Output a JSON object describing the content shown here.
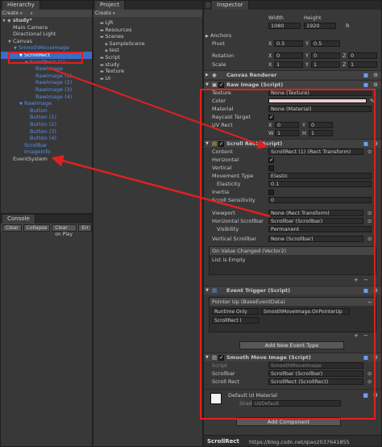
{
  "hierarchy": {
    "tab": "Hierarchy",
    "create": "Create",
    "search_icon": "search-icon",
    "scene": "study*",
    "items": [
      {
        "label": "Main Camera",
        "indent": 1,
        "style": "normal"
      },
      {
        "label": "Directional Light",
        "indent": 1,
        "style": "normal"
      },
      {
        "label": "Canvas",
        "indent": 1,
        "style": "normal"
      },
      {
        "label": "SmoothMoveImage",
        "indent": 2,
        "style": "blue"
      },
      {
        "label": "ScrollRect",
        "indent": 3,
        "style": "selected"
      },
      {
        "label": "ScrollRect (1)",
        "indent": 4,
        "style": "blue"
      },
      {
        "label": "RawImage",
        "indent": 5,
        "style": "blue"
      },
      {
        "label": "RawImage (1)",
        "indent": 5,
        "style": "blue"
      },
      {
        "label": "RawImage (2)",
        "indent": 5,
        "style": "blue"
      },
      {
        "label": "RawImage (3)",
        "indent": 5,
        "style": "blue"
      },
      {
        "label": "RawImage (4)",
        "indent": 5,
        "style": "blue"
      },
      {
        "label": "RawImage",
        "indent": 3,
        "style": "blue"
      },
      {
        "label": "Button",
        "indent": 4,
        "style": "blue"
      },
      {
        "label": "Button (1)",
        "indent": 4,
        "style": "blue"
      },
      {
        "label": "Button (2)",
        "indent": 4,
        "style": "blue"
      },
      {
        "label": "Button (3)",
        "indent": 4,
        "style": "blue"
      },
      {
        "label": "Button (4)",
        "indent": 4,
        "style": "blue"
      },
      {
        "label": "Scrollbar",
        "indent": 3,
        "style": "blue"
      },
      {
        "label": "ImageInfo",
        "indent": 3,
        "style": "blue"
      },
      {
        "label": "EventSystem",
        "indent": 1,
        "style": "normal"
      }
    ]
  },
  "console": {
    "tab": "Console",
    "buttons": [
      "Clear",
      "Collapse",
      "Clear on Play",
      "Err"
    ]
  },
  "project": {
    "tab": "Project",
    "create": "Create",
    "items": [
      {
        "label": "LJR",
        "indent": 1
      },
      {
        "label": "Resources",
        "indent": 1
      },
      {
        "label": "Scenes",
        "indent": 1
      },
      {
        "label": "SampleScene",
        "indent": 2
      },
      {
        "label": "test",
        "indent": 2
      },
      {
        "label": "Script",
        "indent": 1
      },
      {
        "label": "study",
        "indent": 1
      },
      {
        "label": "Texture",
        "indent": 1
      },
      {
        "label": "UI",
        "indent": 1
      }
    ]
  },
  "inspector": {
    "tab": "Inspector",
    "rect": {
      "width_label": "Width",
      "height_label": "Height",
      "width": "1080",
      "height": "1920",
      "anchors": "Anchors",
      "pivot": "Pivot",
      "pivot_x": "0.5",
      "pivot_y": "0.5",
      "rotation": "Rotation",
      "rot_x": "0",
      "rot_y": "0",
      "rot_z": "0",
      "scale": "Scale",
      "scale_x": "1",
      "scale_y": "1",
      "scale_z": "1",
      "x": "X",
      "y": "Y",
      "z": "Z"
    },
    "canvas_renderer": "Canvas Renderer",
    "raw_image": {
      "title": "Raw Image (Script)",
      "texture_label": "Texture",
      "texture": "None (Texture)",
      "color_label": "Color",
      "material_label": "Material",
      "material": "None (Material)",
      "raycast_label": "Raycast Target",
      "uvrect_label": "UV Rect",
      "uv_x": "0",
      "uv_y": "0",
      "uv_w": "1",
      "uv_h": "1",
      "x": "X",
      "y": "Y",
      "w": "W",
      "h": "H"
    },
    "scroll_rect": {
      "title": "Scroll Rect (Script)",
      "content_label": "Content",
      "content": "ScrollRect (1) (Rect Transform)",
      "horizontal_label": "Horizontal",
      "vertical_label": "Vertical",
      "movement_label": "Movement Type",
      "movement": "Elastic",
      "elasticity_label": "Elasticity",
      "elasticity": "0.1",
      "inertia_label": "Inertia",
      "sensitivity_label": "Scroll Sensitivity",
      "sensitivity": "0",
      "viewport_label": "Viewport",
      "viewport": "None (Rect Transform)",
      "hscroll_label": "Horizontal Scrollbar",
      "hscroll": "Scrollbar (Scrollbar)",
      "visibility_label": "Visibility",
      "visibility": "Permanent",
      "vscroll_label": "Vertical Scrollbar",
      "vscroll": "None (Scrollbar)",
      "on_value_changed": "On Value Changed (Vector2)",
      "list_empty": "List is Empty"
    },
    "event_trigger": {
      "title": "Event Trigger (Script)",
      "event": "Pointer Up (BaseEventData)",
      "runtime": "Runtime Only",
      "function": "SmoothMoveImage.OnPointerUp",
      "target": "ScrollRect (",
      "add_event": "Add New Event Type"
    },
    "smooth_move": {
      "title": "Smooth Move Image (Script)",
      "script_label": "Script",
      "script": "SmoothMoveImage",
      "scrollbar_label": "Scrollbar",
      "scrollbar": "Scrollbar (Scrollbar)",
      "scrollrect_label": "Scroll Rect",
      "scrollrect": "ScrollRect (ScrollRect)"
    },
    "material": {
      "name": "Default UI Material",
      "shader_label": "Shader",
      "shader": "UI/Default"
    },
    "add_component": "Add Component",
    "footer": "ScrollRect"
  },
  "watermark": "https://blog.csdn.net/qiao2037641855",
  "colors": {
    "highlight": "#e02020",
    "selection": "#3d6cc2",
    "blue_text": "#5a8fe6"
  }
}
